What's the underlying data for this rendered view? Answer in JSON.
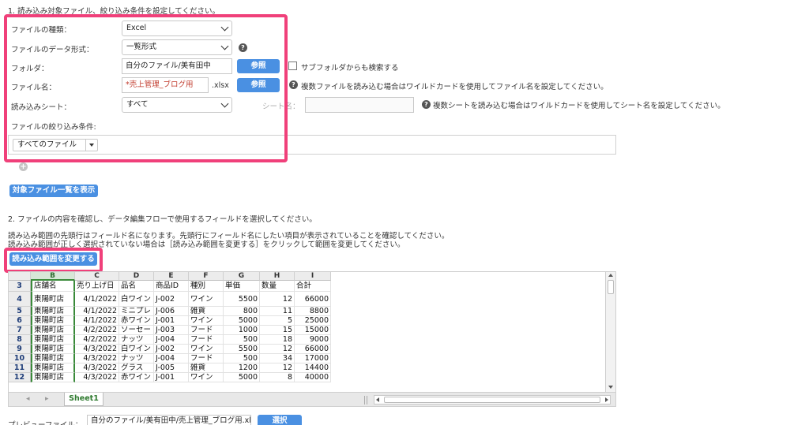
{
  "section1": {
    "title": "1. 読み込み対象ファイル、絞り込み条件を設定してください。",
    "file_type": {
      "label": "ファイルの種類：",
      "value": "Excel"
    },
    "data_format": {
      "label": "ファイルのデータ形式：",
      "value": "一覧形式"
    },
    "folder": {
      "label": "フォルダ：",
      "value": "自分のファイル/美有田中",
      "browse": "参照",
      "subfolder": "サブフォルダからも検索する"
    },
    "filename": {
      "label": "ファイル名：",
      "value": "*売上管理_ブログ用",
      "ext": ".xlsx",
      "browse": "参照",
      "help": "複数ファイルを読み込む場合はワイルドカードを使用してファイル名を設定してください。"
    },
    "sheet": {
      "label": "読み込みシート：",
      "value": "すべて",
      "name_label": "シート名：",
      "help": "複数シートを読み込む場合はワイルドカードを使用してシート名を設定してください。"
    },
    "filter": {
      "label": "ファイルの絞り込み条件:",
      "value": "すべてのファイル"
    },
    "show_list": "対象ファイル一覧を表示"
  },
  "section2": {
    "title": "2. ファイルの内容を確認し、データ編集フローで使用するフィールドを選択してください。",
    "note1": "読み込み範囲の先頭行はフィールド名になります。先頭行にフィールド名にしたい項目が表示されていることを確認してください。",
    "note2": "読み込み範囲が正しく選択されていない場合は［読み込み範囲を変更する］をクリックして範囲を変更してください。",
    "change_range": "読み込み範囲を変更する"
  },
  "sheet": {
    "columns": [
      "B",
      "C",
      "D",
      "E",
      "F",
      "G",
      "H",
      "I"
    ],
    "header_row": "3",
    "headers": [
      "店舗名",
      "売り上げ日",
      "品名",
      "商品ID",
      "種別",
      "単価",
      "数量",
      "合計"
    ],
    "rows": [
      {
        "n": "4",
        "cells": [
          "東陽町店",
          "4/1/2022",
          "白ワイン",
          "J-002",
          "ワイン",
          "5500",
          "12",
          "66000"
        ]
      },
      {
        "n": "5",
        "cells": [
          "東陽町店",
          "4/1/2022",
          "ミニプレ",
          "J-006",
          "雑貨",
          "800",
          "11",
          "8800"
        ]
      },
      {
        "n": "6",
        "cells": [
          "東陽町店",
          "4/1/2022",
          "赤ワイン",
          "J-001",
          "ワイン",
          "5000",
          "5",
          "25000"
        ]
      },
      {
        "n": "7",
        "cells": [
          "東陽町店",
          "4/2/2022",
          "ソーセー",
          "J-003",
          "フード",
          "1000",
          "15",
          "15000"
        ]
      },
      {
        "n": "8",
        "cells": [
          "東陽町店",
          "4/2/2022",
          "ナッツ",
          "J-004",
          "フード",
          "500",
          "18",
          "9000"
        ]
      },
      {
        "n": "9",
        "cells": [
          "東陽町店",
          "4/3/2022",
          "白ワイン",
          "J-002",
          "ワイン",
          "5500",
          "12",
          "66000"
        ]
      },
      {
        "n": "10",
        "cells": [
          "東陽町店",
          "4/3/2022",
          "ナッツ",
          "J-004",
          "フード",
          "500",
          "34",
          "17000"
        ]
      },
      {
        "n": "11",
        "cells": [
          "東陽町店",
          "4/3/2022",
          "グラス",
          "J-005",
          "雑貨",
          "1200",
          "12",
          "14400"
        ]
      },
      {
        "n": "12",
        "cells": [
          "東陽町店",
          "4/3/2022",
          "赤ワイン",
          "J-001",
          "ワイン",
          "5000",
          "8",
          "40000"
        ]
      }
    ],
    "tab": "Sheet1"
  },
  "preview": {
    "label": "プレビューファイル：",
    "value": "自分のファイル/美有田中/売上管理_ブログ用.xlsx",
    "select": "選択"
  }
}
